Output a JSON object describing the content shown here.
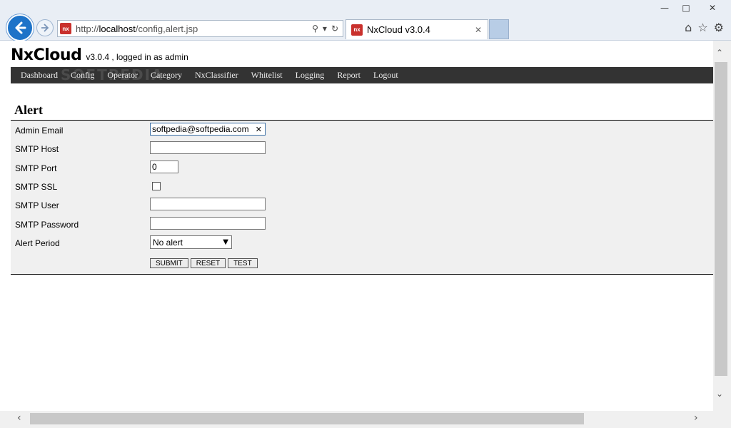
{
  "browser": {
    "url_prefix": "http://",
    "url_host": "localhost",
    "url_path": "/config,alert.jsp",
    "tab_title": "NxCloud v3.0.4",
    "favicon_text": "nx"
  },
  "app": {
    "logo": "NxCloud",
    "version_text": "v3.0.4 , logged in as admin",
    "watermark": "SOFTPEDIA"
  },
  "nav": [
    "Dashboard",
    "Config",
    "Operator",
    "Category",
    "NxClassifier",
    "Whitelist",
    "Logging",
    "Report",
    "Logout"
  ],
  "form": {
    "title": "Alert",
    "admin_email_label": "Admin Email",
    "admin_email_value": "softpedia@softpedia.com",
    "smtp_host_label": "SMTP Host",
    "smtp_host_value": "",
    "smtp_port_label": "SMTP Port",
    "smtp_port_value": "0",
    "smtp_ssl_label": "SMTP SSL",
    "smtp_user_label": "SMTP User",
    "smtp_user_value": "",
    "smtp_password_label": "SMTP Password",
    "smtp_password_value": "",
    "alert_period_label": "Alert Period",
    "alert_period_value": "No alert",
    "submit": "SUBMIT",
    "reset": "RESET",
    "test": "TEST"
  }
}
